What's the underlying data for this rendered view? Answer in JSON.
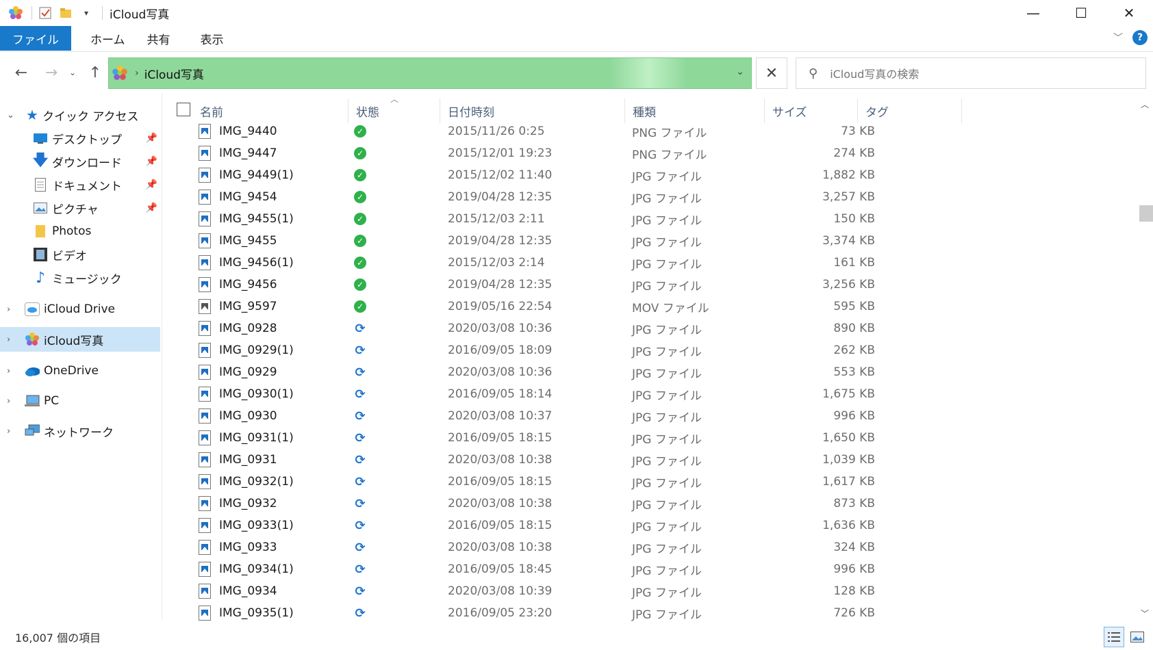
{
  "window": {
    "title": "iCloud写真",
    "controls": {
      "minimize": "—",
      "maximize": "☐",
      "close": "✕"
    }
  },
  "ribbon": {
    "tabs": [
      "ファイル",
      "ホーム",
      "共有",
      "表示"
    ],
    "help": "?"
  },
  "address": {
    "path": "iCloud写真",
    "search_placeholder": "iCloud写真の検索"
  },
  "sidebar": {
    "quick_access": "クイック アクセス",
    "quick_items": [
      {
        "label": "デスクトップ",
        "pinned": true,
        "icon": "desktop-icon"
      },
      {
        "label": "ダウンロード",
        "pinned": true,
        "icon": "download-icon"
      },
      {
        "label": "ドキュメント",
        "pinned": true,
        "icon": "documents-icon"
      },
      {
        "label": "ピクチャ",
        "pinned": true,
        "icon": "pictures-icon"
      },
      {
        "label": "Photos",
        "pinned": false,
        "icon": "folder-icon"
      },
      {
        "label": "ビデオ",
        "pinned": false,
        "icon": "video-icon"
      },
      {
        "label": "ミュージック",
        "pinned": false,
        "icon": "music-icon"
      }
    ],
    "roots": [
      {
        "label": "iCloud Drive",
        "icon": "icloud-drive-icon",
        "selected": false
      },
      {
        "label": "iCloud写真",
        "icon": "photos-icon",
        "selected": true
      },
      {
        "label": "OneDrive",
        "icon": "onedrive-icon",
        "selected": false
      },
      {
        "label": "PC",
        "icon": "pc-icon",
        "selected": false
      },
      {
        "label": "ネットワーク",
        "icon": "network-icon",
        "selected": false
      }
    ]
  },
  "columns": {
    "name": "名前",
    "state": "状態",
    "date": "日付時刻",
    "type": "種類",
    "size": "サイズ",
    "tag": "タグ"
  },
  "files": [
    {
      "name": "IMG_9440",
      "state": "synced",
      "date": "2015/11/26 0:25",
      "type": "PNG ファイル",
      "size": "73 KB"
    },
    {
      "name": "IMG_9447",
      "state": "synced",
      "date": "2015/12/01 19:23",
      "type": "PNG ファイル",
      "size": "274 KB"
    },
    {
      "name": "IMG_9449(1)",
      "state": "synced",
      "date": "2015/12/02 11:40",
      "type": "JPG ファイル",
      "size": "1,882 KB"
    },
    {
      "name": "IMG_9454",
      "state": "synced",
      "date": "2019/04/28 12:35",
      "type": "JPG ファイル",
      "size": "3,257 KB"
    },
    {
      "name": "IMG_9455(1)",
      "state": "synced",
      "date": "2015/12/03 2:11",
      "type": "JPG ファイル",
      "size": "150 KB"
    },
    {
      "name": "IMG_9455",
      "state": "synced",
      "date": "2019/04/28 12:35",
      "type": "JPG ファイル",
      "size": "3,374 KB"
    },
    {
      "name": "IMG_9456(1)",
      "state": "synced",
      "date": "2015/12/03 2:14",
      "type": "JPG ファイル",
      "size": "161 KB"
    },
    {
      "name": "IMG_9456",
      "state": "synced",
      "date": "2019/04/28 12:35",
      "type": "JPG ファイル",
      "size": "3,256 KB"
    },
    {
      "name": "IMG_9597",
      "state": "synced",
      "date": "2019/05/16 22:54",
      "type": "MOV ファイル",
      "size": "595 KB"
    },
    {
      "name": "IMG_0928",
      "state": "syncing",
      "date": "2020/03/08 10:36",
      "type": "JPG ファイル",
      "size": "890 KB"
    },
    {
      "name": "IMG_0929(1)",
      "state": "syncing",
      "date": "2016/09/05 18:09",
      "type": "JPG ファイル",
      "size": "262 KB"
    },
    {
      "name": "IMG_0929",
      "state": "syncing",
      "date": "2020/03/08 10:36",
      "type": "JPG ファイル",
      "size": "553 KB"
    },
    {
      "name": "IMG_0930(1)",
      "state": "syncing",
      "date": "2016/09/05 18:14",
      "type": "JPG ファイル",
      "size": "1,675 KB"
    },
    {
      "name": "IMG_0930",
      "state": "syncing",
      "date": "2020/03/08 10:37",
      "type": "JPG ファイル",
      "size": "996 KB"
    },
    {
      "name": "IMG_0931(1)",
      "state": "syncing",
      "date": "2016/09/05 18:15",
      "type": "JPG ファイル",
      "size": "1,650 KB"
    },
    {
      "name": "IMG_0931",
      "state": "syncing",
      "date": "2020/03/08 10:38",
      "type": "JPG ファイル",
      "size": "1,039 KB"
    },
    {
      "name": "IMG_0932(1)",
      "state": "syncing",
      "date": "2016/09/05 18:15",
      "type": "JPG ファイル",
      "size": "1,617 KB"
    },
    {
      "name": "IMG_0932",
      "state": "syncing",
      "date": "2020/03/08 10:38",
      "type": "JPG ファイル",
      "size": "873 KB"
    },
    {
      "name": "IMG_0933(1)",
      "state": "syncing",
      "date": "2016/09/05 18:15",
      "type": "JPG ファイル",
      "size": "1,636 KB"
    },
    {
      "name": "IMG_0933",
      "state": "syncing",
      "date": "2020/03/08 10:38",
      "type": "JPG ファイル",
      "size": "324 KB"
    },
    {
      "name": "IMG_0934(1)",
      "state": "syncing",
      "date": "2016/09/05 18:45",
      "type": "JPG ファイル",
      "size": "996 KB"
    },
    {
      "name": "IMG_0934",
      "state": "syncing",
      "date": "2020/03/08 10:39",
      "type": "JPG ファイル",
      "size": "128 KB"
    },
    {
      "name": "IMG_0935(1)",
      "state": "syncing",
      "date": "2016/09/05 23:20",
      "type": "JPG ファイル",
      "size": "726 KB"
    }
  ],
  "status": {
    "item_count": "16,007 個の項目"
  },
  "colors": {
    "accent": "#1979ca",
    "address_bar": "#8ed89a",
    "synced": "#2eb14a",
    "syncing": "#1e74d1",
    "selection": "#cce4f7"
  }
}
